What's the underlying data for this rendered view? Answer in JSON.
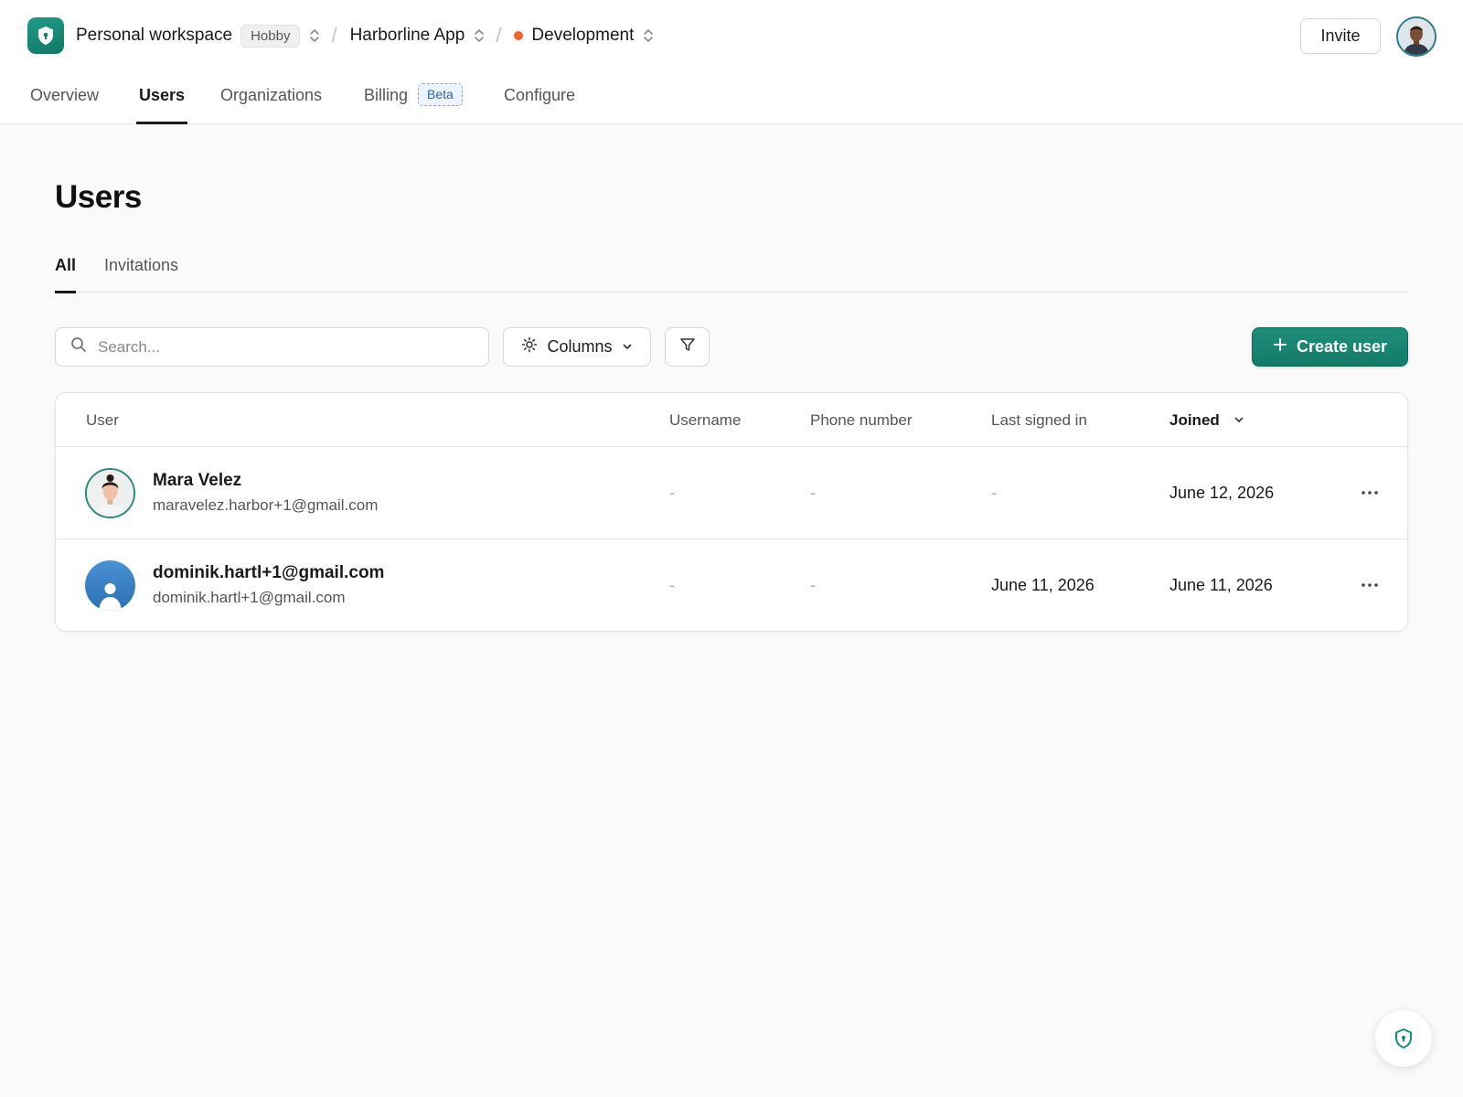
{
  "header": {
    "workspace_name": "Personal workspace",
    "plan_badge": "Hobby",
    "app_name": "Harborline App",
    "environment": "Development",
    "environment_color": "#f0652e",
    "invite_label": "Invite",
    "brand_color": "#1a8a78"
  },
  "nav": {
    "tabs": [
      {
        "label": "Overview"
      },
      {
        "label": "Users"
      },
      {
        "label": "Organizations"
      },
      {
        "label": "Billing",
        "badge": "Beta"
      },
      {
        "label": "Configure"
      }
    ],
    "active": "Users"
  },
  "page": {
    "title": "Users",
    "subtabs": [
      {
        "label": "All"
      },
      {
        "label": "Invitations"
      }
    ],
    "active_subtab": "All"
  },
  "toolbar": {
    "search_placeholder": "Search...",
    "search_value": "",
    "columns_label": "Columns",
    "create_label": "Create user"
  },
  "table": {
    "columns": [
      "User",
      "Username",
      "Phone number",
      "Last signed in",
      "Joined"
    ],
    "sorted_column": "Joined",
    "rows": [
      {
        "name": "Mara Velez",
        "email": "maravelez.harbor+1@gmail.com",
        "username": "-",
        "phone": "-",
        "last_signed_in": "-",
        "joined": "June 12, 2026"
      },
      {
        "name": "dominik.hartl+1@gmail.com",
        "email": "dominik.hartl+1@gmail.com",
        "username": "-",
        "phone": "-",
        "last_signed_in": "June 11, 2026",
        "joined": "June 11, 2026"
      }
    ]
  },
  "icons": {
    "logo": "shield-icon",
    "switcher": "chevron-up-down-icon",
    "search": "search-icon",
    "columns": "gear-icon",
    "columns_caret": "chevron-down-icon",
    "filter": "filter-icon",
    "create": "plus-icon",
    "row_actions": "more-horizontal-icon",
    "help": "shield-icon"
  }
}
